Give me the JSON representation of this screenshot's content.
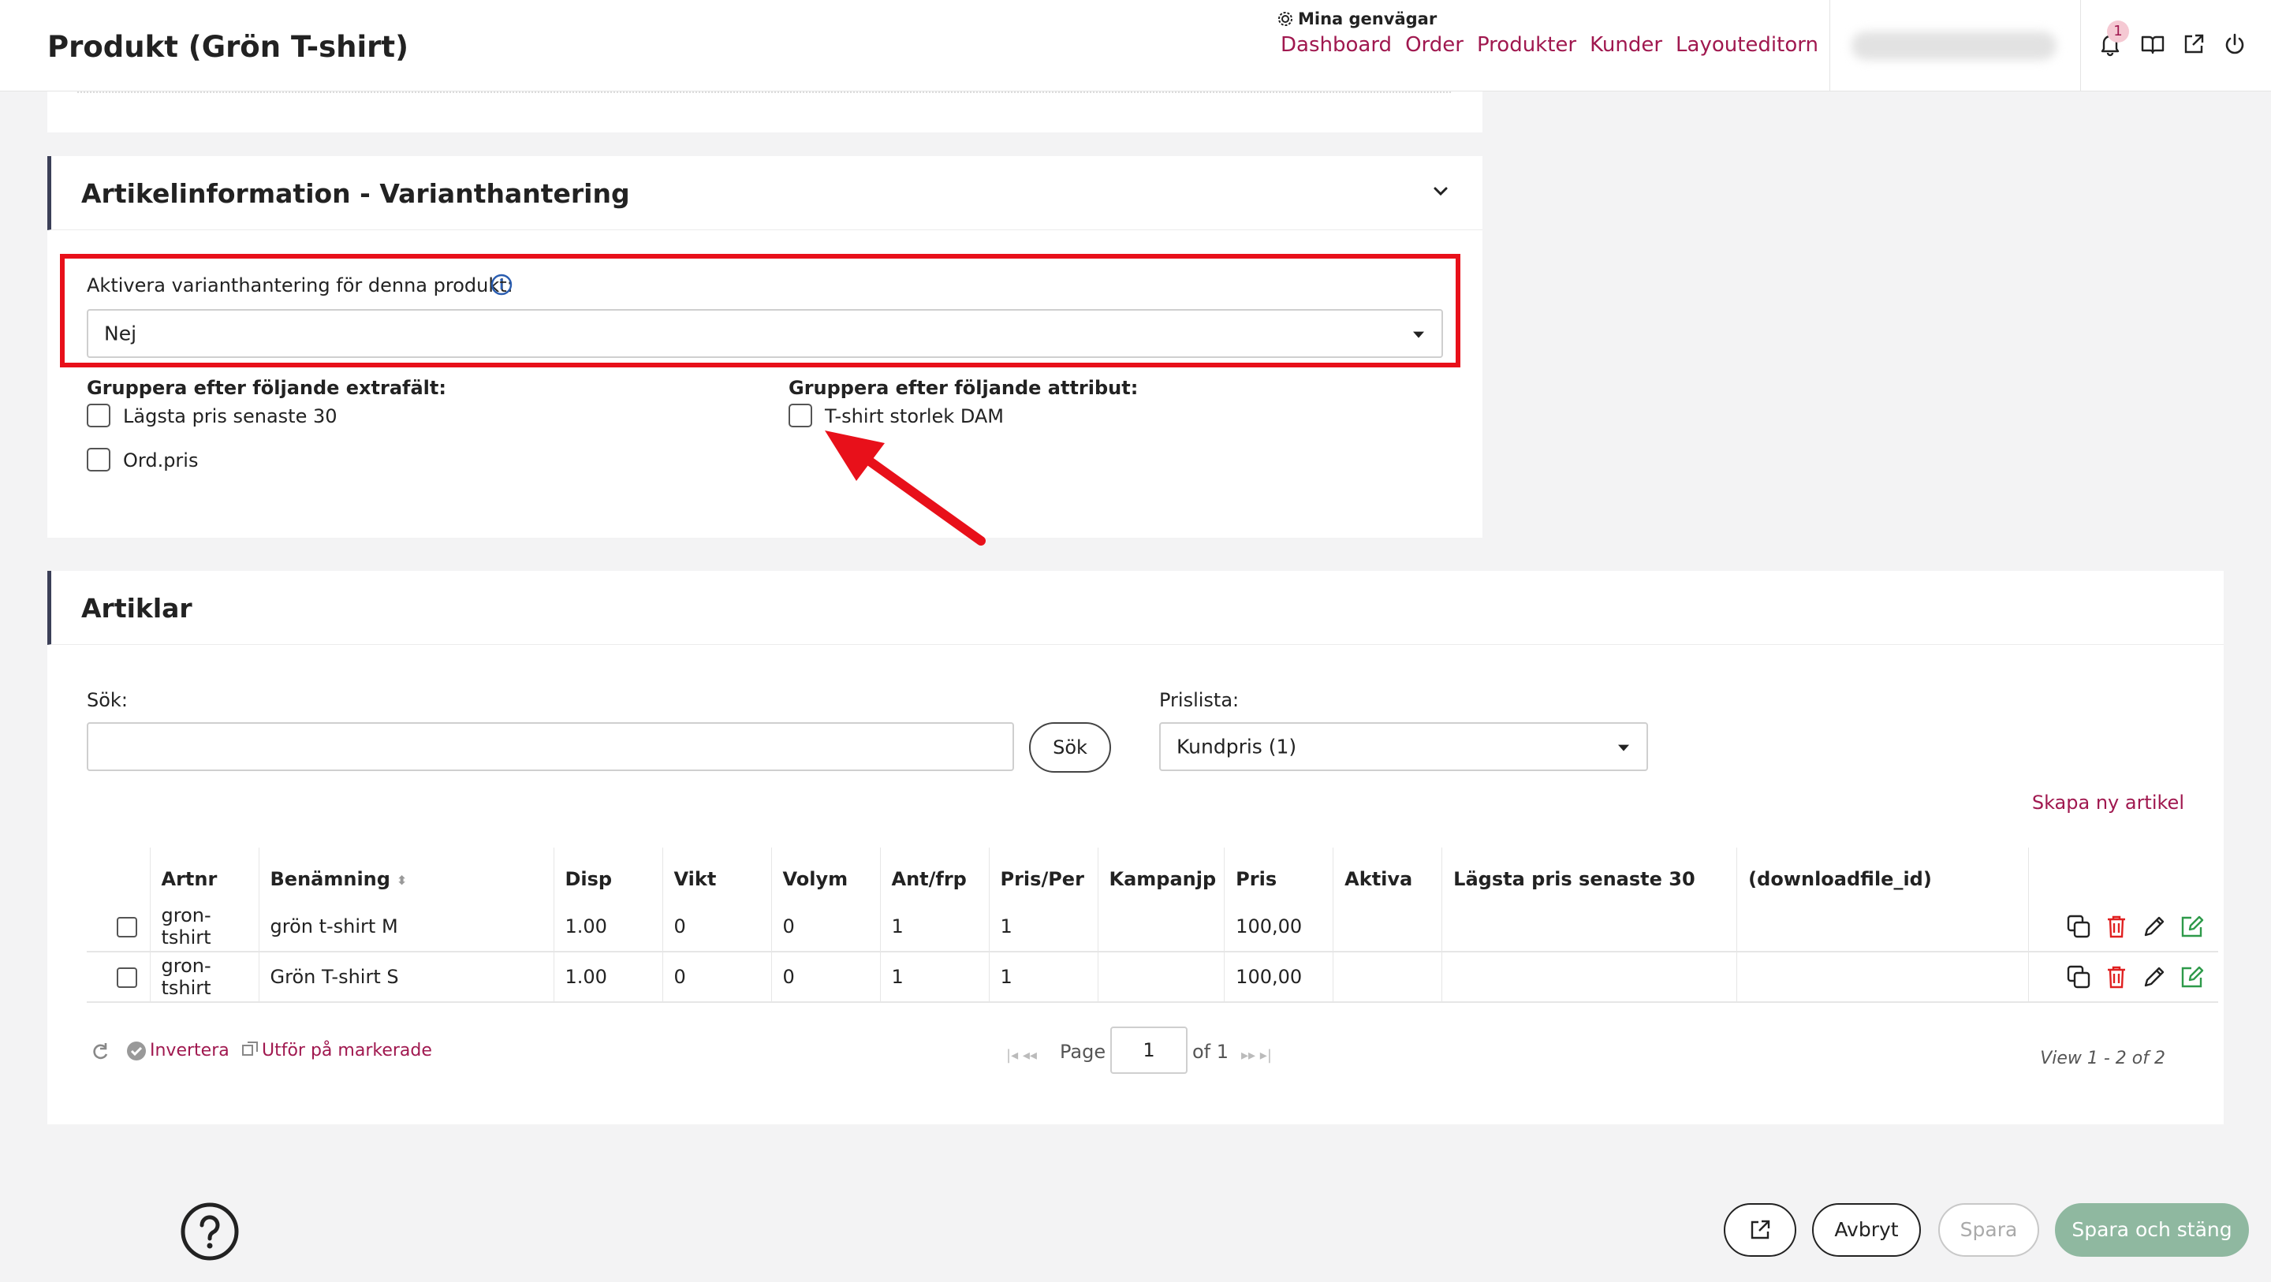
{
  "header": {
    "title": "Produkt (Grön T-shirt)",
    "shortcuts_title": "Mina genvägar",
    "shortcuts": [
      "Dashboard",
      "Order",
      "Produkter",
      "Kunder",
      "Layouteditorn"
    ],
    "notification_count": "1"
  },
  "variant_card": {
    "title": "Artikelinformation - Varianthantering",
    "activate_label": "Aktivera varianthantering för denna produkt:",
    "activate_value": "Nej",
    "extra_fields_label": "Gruppera efter följande extrafält:",
    "extra_fields": [
      "Lägsta pris senaste 30",
      "Ord.pris"
    ],
    "attributes_label": "Gruppera efter följande attribut:",
    "attributes": [
      "T-shirt storlek DAM"
    ]
  },
  "articles_card": {
    "title": "Artiklar",
    "search_label": "Sök:",
    "search_value": "",
    "search_button": "Sök",
    "pricelist_label": "Prislista:",
    "pricelist_value": "Kundpris (1)",
    "create_link": "Skapa ny artikel",
    "columns": [
      "Artnr",
      "Benämning",
      "Disp",
      "Vikt",
      "Volym",
      "Ant/frp",
      "Pris/Per",
      "Kampanjp",
      "Pris",
      "Aktiva",
      "Lägsta pris senaste 30",
      "(downloadfile_id)"
    ],
    "rows": [
      {
        "artnr": "gron-tshirt",
        "benamning": "grön t-shirt M",
        "disp": "1.00",
        "vikt": "0",
        "volym": "0",
        "antfrp": "1",
        "prisper": "1",
        "kampanjp": "",
        "pris": "100,00",
        "aktiva": "",
        "lagsta": "",
        "download": ""
      },
      {
        "artnr": "gron-tshirt",
        "benamning": "Grön T-shirt S",
        "disp": "1.00",
        "vikt": "0",
        "volym": "0",
        "antfrp": "1",
        "prisper": "1",
        "kampanjp": "",
        "pris": "100,00",
        "aktiva": "",
        "lagsta": "",
        "download": ""
      }
    ],
    "invert_label": "Invertera",
    "bulk_label": "Utför på markerade",
    "page_label": "Page",
    "page_value": "1",
    "of_label": "of 1",
    "view_info": "View 1 - 2 of 2"
  },
  "footer": {
    "cancel": "Avbryt",
    "save": "Spara",
    "save_close": "Spara och stäng"
  },
  "colors": {
    "accent": "#a0184f",
    "highlight": "#e8101a",
    "save_close_bg": "#8fb8a0"
  }
}
